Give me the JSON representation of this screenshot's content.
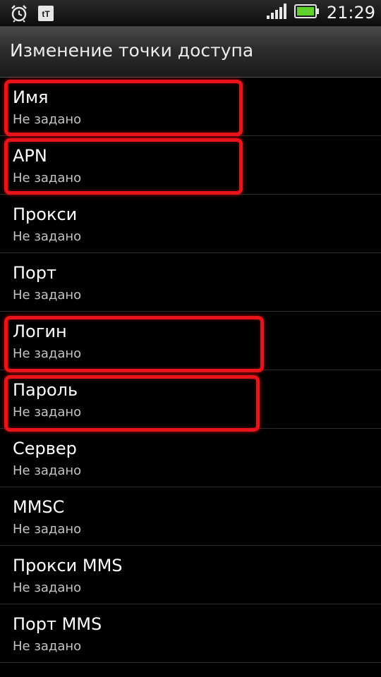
{
  "status_bar": {
    "time": "21:29",
    "icons": [
      "alarm-clock-icon",
      "operator-logo-icon",
      "signal-strength-icon",
      "battery-charging-icon"
    ],
    "operator_logo_text": "tT"
  },
  "header": {
    "title": "Изменение точки доступа"
  },
  "items": [
    {
      "title": "Имя",
      "value": "Не задано",
      "highlighted": true
    },
    {
      "title": "APN",
      "value": "Не задано",
      "highlighted": true
    },
    {
      "title": "Прокси",
      "value": "Не задано",
      "highlighted": false
    },
    {
      "title": "Порт",
      "value": "Не задано",
      "highlighted": false
    },
    {
      "title": "Логин",
      "value": "Не задано",
      "highlighted": true
    },
    {
      "title": "Пароль",
      "value": "Не задано",
      "highlighted": true
    },
    {
      "title": "Сервер",
      "value": "Не задано",
      "highlighted": false
    },
    {
      "title": "MMSC",
      "value": "Не задано",
      "highlighted": false
    },
    {
      "title": "Прокси MMS",
      "value": "Не задано",
      "highlighted": false
    },
    {
      "title": "Порт MMS",
      "value": "Не задано",
      "highlighted": false
    }
  ],
  "colors": {
    "highlight": "#e8141a",
    "battery": "#5fd12a",
    "background": "#000000"
  }
}
